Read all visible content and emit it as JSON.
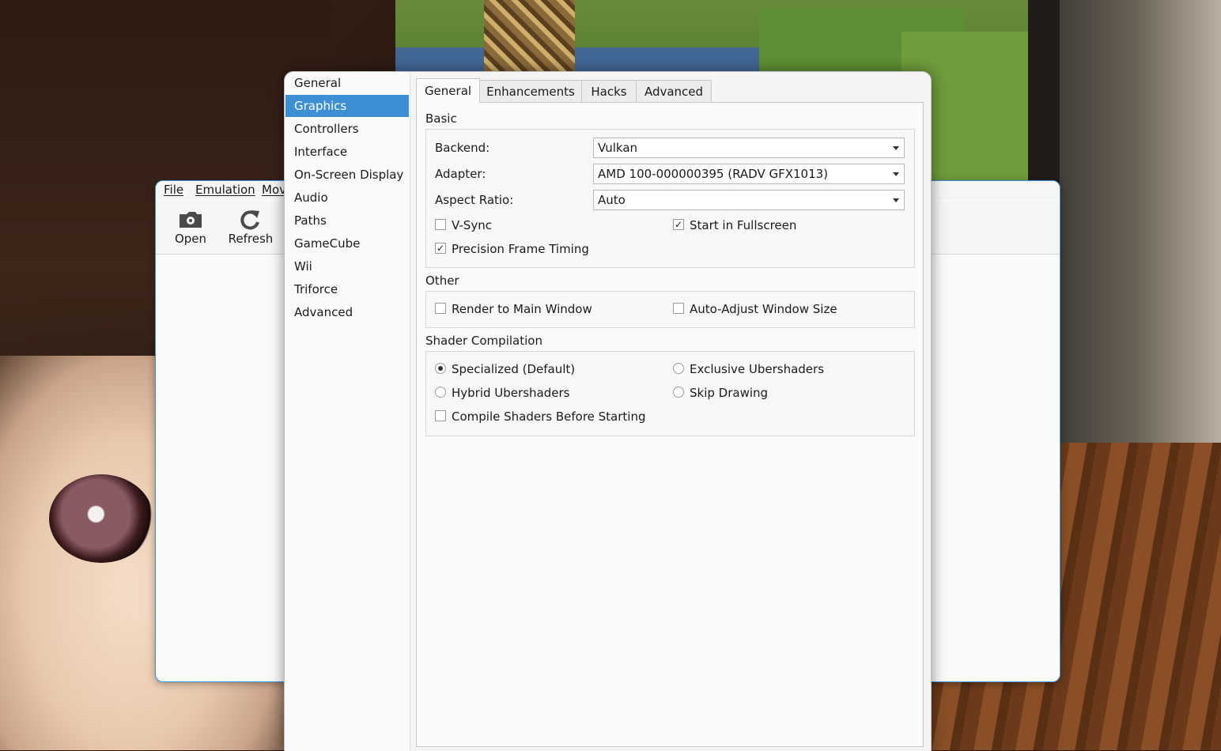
{
  "main_window": {
    "menu": [
      "File",
      "Emulation",
      "Mov"
    ],
    "toolbar": [
      {
        "label": "Open",
        "icon": "folder-open-icon"
      },
      {
        "label": "Refresh",
        "icon": "refresh-icon"
      }
    ]
  },
  "settings": {
    "sidebar": {
      "items": [
        "General",
        "Graphics",
        "Controllers",
        "Interface",
        "On-Screen Display",
        "Audio",
        "Paths",
        "GameCube",
        "Wii",
        "Triforce",
        "Advanced"
      ],
      "active": "Graphics"
    },
    "tabs": {
      "items": [
        "General",
        "Enhancements",
        "Hacks",
        "Advanced"
      ],
      "active": "General"
    },
    "basic": {
      "title": "Basic",
      "backend_label": "Backend:",
      "backend_value": "Vulkan",
      "adapter_label": "Adapter:",
      "adapter_value": "AMD 100-000000395 (RADV GFX1013)",
      "aspect_label": "Aspect Ratio:",
      "aspect_value": "Auto",
      "vsync": {
        "label": "V-Sync",
        "checked": false
      },
      "fullscreen": {
        "label": "Start in Fullscreen",
        "checked": true
      },
      "precision": {
        "label": "Precision Frame Timing",
        "checked": true
      }
    },
    "other": {
      "title": "Other",
      "render_main": {
        "label": "Render to Main Window",
        "checked": false
      },
      "auto_adjust": {
        "label": "Auto-Adjust Window Size",
        "checked": false
      }
    },
    "shader": {
      "title": "Shader Compilation",
      "specialized": {
        "label": "Specialized (Default)",
        "checked": true
      },
      "exclusive": {
        "label": "Exclusive Ubershaders",
        "checked": false
      },
      "hybrid": {
        "label": "Hybrid Ubershaders",
        "checked": false
      },
      "skip": {
        "label": "Skip Drawing",
        "checked": false
      },
      "compile_before": {
        "label": "Compile Shaders Before Starting",
        "checked": false
      }
    }
  }
}
